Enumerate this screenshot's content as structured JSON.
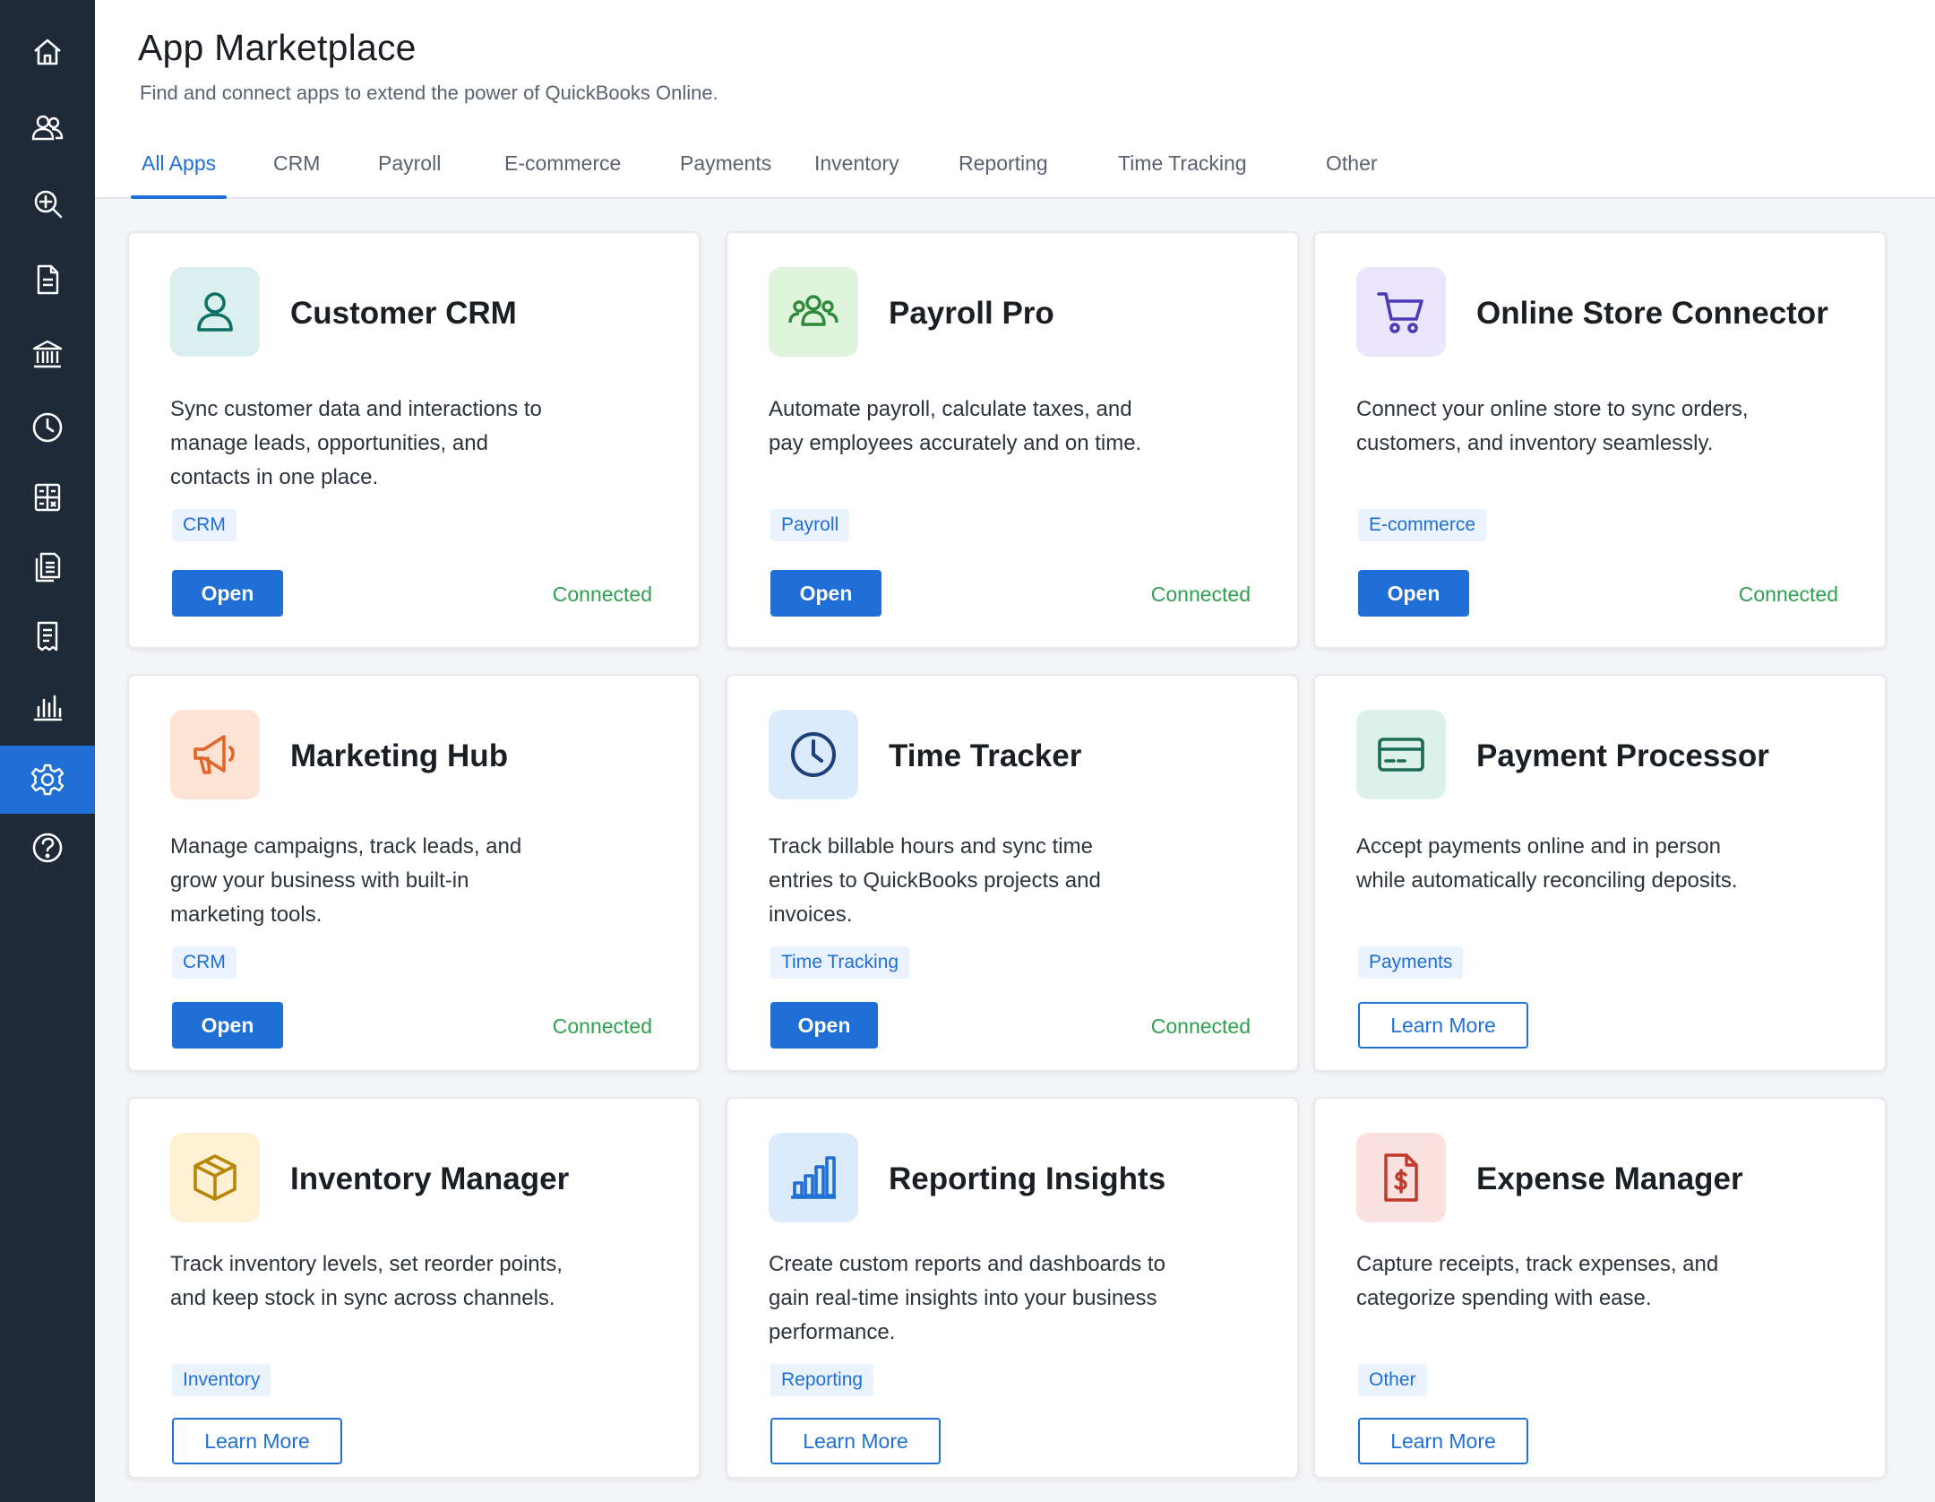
{
  "colors": {
    "accent": "#1f6fd6",
    "sidebar_bg": "#1e2a38",
    "connected": "#2ea04f"
  },
  "sidebar": {
    "items": [
      {
        "icon": "home-icon"
      },
      {
        "icon": "users-icon"
      },
      {
        "icon": "search-plus-icon"
      },
      {
        "icon": "document-icon"
      },
      {
        "icon": "bank-icon"
      },
      {
        "icon": "clock-icon"
      },
      {
        "icon": "calculator-icon"
      },
      {
        "icon": "documents-icon"
      },
      {
        "icon": "receipt-icon"
      },
      {
        "icon": "bar-chart-icon"
      },
      {
        "icon": "gear-icon",
        "active": true
      },
      {
        "icon": "help-icon"
      }
    ]
  },
  "header": {
    "title": "App Marketplace",
    "subtitle": "Find and connect apps to extend the power of QuickBooks Online."
  },
  "tabs": [
    {
      "label": "All Apps",
      "active": true
    },
    {
      "label": "CRM"
    },
    {
      "label": "Payroll"
    },
    {
      "label": "E-commerce"
    },
    {
      "label": "Payments"
    },
    {
      "label": "Inventory"
    },
    {
      "label": "Reporting"
    },
    {
      "label": "Time Tracking"
    },
    {
      "label": "Other"
    }
  ],
  "apps": [
    {
      "icon": "person-icon",
      "icon_bg": "#d9f0ee",
      "icon_color": "#0f6f66",
      "title": "Customer CRM",
      "description": "Sync customer data and interactions to manage leads, opportunities, and contacts in one place.",
      "tag": "CRM",
      "action": "Open",
      "status": "Connected"
    },
    {
      "icon": "team-icon",
      "icon_bg": "#e0f3dc",
      "icon_color": "#2e8a3a",
      "title": "Payroll Pro",
      "description": "Automate payroll, calculate taxes, and pay employees accurately and on time.",
      "tag": "Payroll",
      "action": "Open",
      "status": "Connected"
    },
    {
      "icon": "cart-icon",
      "icon_bg": "#ebe6fb",
      "icon_color": "#4b3bb8",
      "title": "Online Store Connector",
      "description": "Connect your online store to sync orders, customers, and inventory seamlessly.",
      "tag": "E-commerce",
      "action": "Open",
      "status": "Connected"
    },
    {
      "icon": "megaphone-icon",
      "icon_bg": "#fde3d3",
      "icon_color": "#e0672a",
      "title": "Marketing Hub",
      "description": "Manage campaigns, track leads, and grow your business with built-in marketing tools.",
      "tag": "CRM",
      "action": "Open",
      "status": "Connected"
    },
    {
      "icon": "clock-icon",
      "icon_bg": "#dcebfb",
      "icon_color": "#1f3f78",
      "title": "Time Tracker",
      "description": "Track billable hours and sync time entries to QuickBooks projects and invoices.",
      "tag": "Time Tracking",
      "action": "Open",
      "status": "Connected"
    },
    {
      "icon": "credit-card-icon",
      "icon_bg": "#dcf1e9",
      "icon_color": "#1d6b55",
      "title": "Payment Processor",
      "description": "Accept payments online and in person while automatically reconciling deposits.",
      "tag": "Payments",
      "action": "Learn More",
      "status": ""
    },
    {
      "icon": "box-icon",
      "icon_bg": "#fdf0d3",
      "icon_color": "#b8860b",
      "title": "Inventory Manager",
      "description": "Track inventory levels, set reorder points, and keep stock in sync across channels.",
      "tag": "Inventory",
      "action": "Learn More",
      "status": ""
    },
    {
      "icon": "bar-chart-icon",
      "icon_bg": "#dcebfb",
      "icon_color": "#1f6fd6",
      "title": "Reporting Insights",
      "description": "Create custom reports and dashboards to gain real-time insights into your business performance.",
      "tag": "Reporting",
      "action": "Learn More",
      "status": ""
    },
    {
      "icon": "expense-icon",
      "icon_bg": "#fbe0e0",
      "icon_color": "#c0392b",
      "title": "Expense Manager",
      "description": "Capture receipts, track expenses, and categorize spending with ease.",
      "tag": "Other",
      "action": "Learn More",
      "status": ""
    }
  ]
}
